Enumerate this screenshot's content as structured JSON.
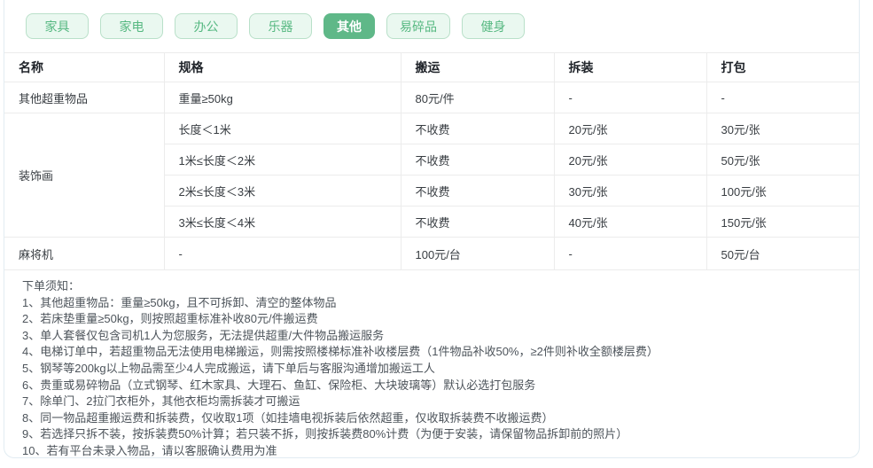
{
  "colors": {
    "active_tab_bg": "#5fb888",
    "active_tab_text": "#ffffff",
    "inactive_tab_bg": "#eaf8f0",
    "inactive_tab_border": "#b9e0c9",
    "inactive_tab_text": "#56b881",
    "card_border": "#e2ecf2",
    "table_border": "#ececec"
  },
  "tabs": {
    "items": [
      {
        "label": "家具",
        "active": false
      },
      {
        "label": "家电",
        "active": false
      },
      {
        "label": "办公",
        "active": false
      },
      {
        "label": "乐器",
        "active": false
      },
      {
        "label": "其他",
        "active": true
      },
      {
        "label": "易碎品",
        "active": false
      },
      {
        "label": "健身",
        "active": false
      }
    ]
  },
  "table": {
    "headers": [
      "名称",
      "规格",
      "搬运",
      "拆装",
      "打包"
    ],
    "groups": [
      {
        "name": "其他超重物品",
        "rows": [
          {
            "spec": "重量≥50kg",
            "carry": "80元/件",
            "disassembly": "-",
            "packing": "-"
          }
        ]
      },
      {
        "name": "装饰画",
        "rows": [
          {
            "spec": "长度＜1米",
            "carry": "不收费",
            "disassembly": "20元/张",
            "packing": "30元/张"
          },
          {
            "spec": "1米≤长度＜2米",
            "carry": "不收费",
            "disassembly": "20元/张",
            "packing": "50元/张"
          },
          {
            "spec": "2米≤长度＜3米",
            "carry": "不收费",
            "disassembly": "30元/张",
            "packing": "100元/张"
          },
          {
            "spec": "3米≤长度＜4米",
            "carry": "不收费",
            "disassembly": "40元/张",
            "packing": "150元/张"
          }
        ]
      },
      {
        "name": "麻将机",
        "rows": [
          {
            "spec": "-",
            "carry": "100元/台",
            "disassembly": "-",
            "packing": "50元/台"
          }
        ]
      }
    ]
  },
  "notes": {
    "title": "下单须知：",
    "items": [
      "1、其他超重物品：重量≥50kg，且不可拆卸、清空的整体物品",
      "2、若床垫重量≥50kg，则按照超重标准补收80元/件搬运费",
      "3、单人套餐仅包含司机1人为您服务，无法提供超重/大件物品搬运服务",
      "4、电梯订单中，若超重物品无法使用电梯搬运，则需按照楼梯标准补收楼层费（1件物品补收50%，≥2件则补收全额楼层费）",
      "5、钢琴等200kg以上物品需至少4人完成搬运，请下单后与客服沟通增加搬运工人",
      "6、贵重或易碎物品（立式钢琴、红木家具、大理石、鱼缸、保险柜、大块玻璃等）默认必选打包服务",
      "7、除单门、2拉门衣柜外，其他衣柜均需拆装才可搬运",
      "8、同一物品超重搬运费和拆装费，仅收取1项（如挂墙电视拆装后依然超重，仅收取拆装费不收搬运费）",
      "9、若选择只拆不装，按拆装费50%计算；若只装不拆，则按拆装费80%计费（为便于安装，请保留物品拆卸前的照片）",
      "10、若有平台未录入物品，请以客服确认费用为准"
    ]
  }
}
